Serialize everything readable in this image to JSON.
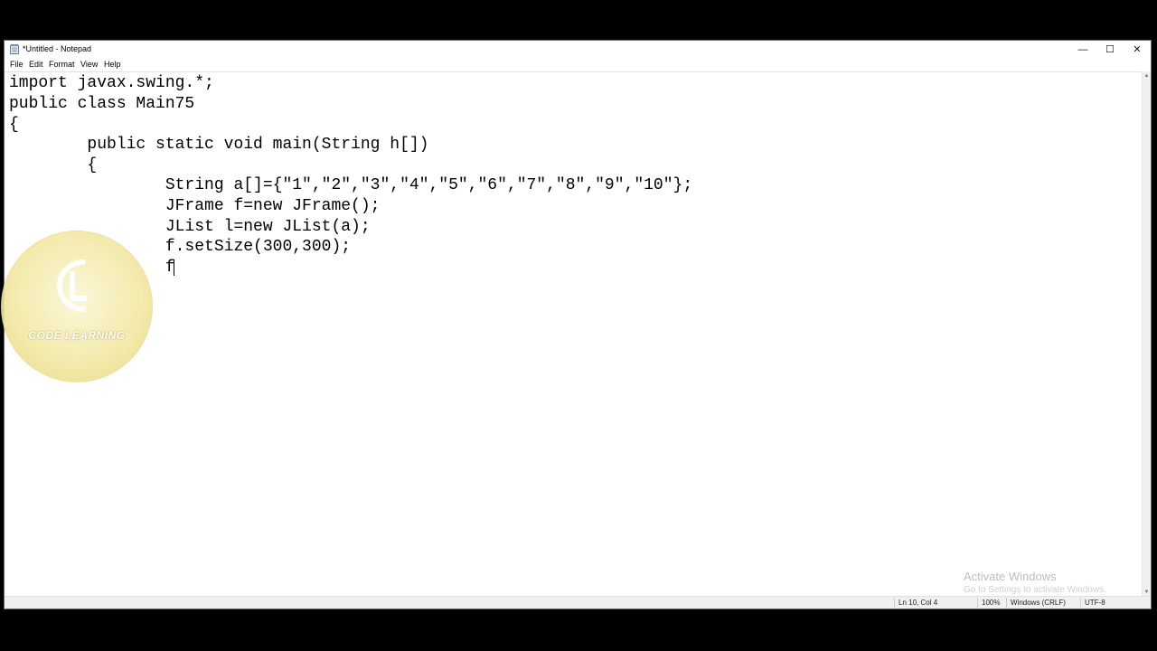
{
  "window": {
    "title": "*Untitled - Notepad",
    "controls": {
      "minimize": "—",
      "maximize": "☐",
      "close": "✕"
    }
  },
  "menu": {
    "file": "File",
    "edit": "Edit",
    "format": "Format",
    "view": "View",
    "help": "Help"
  },
  "editor": {
    "lines": [
      "import javax.swing.*;",
      "public class Main75",
      "{",
      "        public static void main(String h[])",
      "        {",
      "                String a[]={\"1\",\"2\",\"3\",\"4\",\"5\",\"6\",\"7\",\"8\",\"9\",\"10\"};",
      "                JFrame f=new JFrame();",
      "                JList l=new JList(a);",
      "                f.setSize(300,300);",
      "                f"
    ]
  },
  "status": {
    "position": "Ln 10, Col 4",
    "zoom": "100%",
    "line_ending": "Windows (CRLF)",
    "encoding": "UTF-8"
  },
  "activation": {
    "title": "Activate Windows",
    "subtitle": "Go to Settings to activate Windows."
  },
  "logo": {
    "text": "CODE LEARNING"
  },
  "icons": {
    "app": "notepad-icon",
    "logo": "code-learning-logo"
  },
  "colors": {
    "background": "#000000",
    "window": "#ffffff",
    "statusbar": "#f0f0f0",
    "logo": "#f3eaa8"
  }
}
